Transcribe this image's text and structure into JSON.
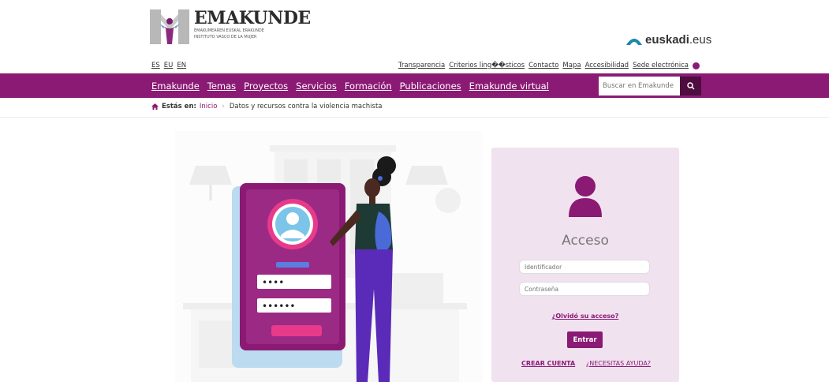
{
  "header": {
    "logo_title": "EMAKUNDE",
    "logo_sub1": "EMAKUMEAREN EUSKAL ERAKUNDE",
    "logo_sub2": "INSTITUTO VASCO DE LA MUJER",
    "gov_brand": "euskadi",
    "gov_tld": ".eus"
  },
  "languages": [
    "ES",
    "EU",
    "EN"
  ],
  "utility_links": [
    "Transparencia",
    "Criterios ling��sticos",
    "Contacto",
    "Mapa",
    "Accesibilidad",
    "Sede electrónica"
  ],
  "nav": {
    "items": [
      "Emakunde",
      "Temas",
      "Proyectos",
      "Servicios",
      "Formación",
      "Publicaciones",
      "Emakunde virtual"
    ],
    "search_placeholder": "Buscar en Emakunde"
  },
  "breadcrumb": {
    "label": "Estás en:",
    "home": "Inicio",
    "current": "Datos y recursos contra la violencia machista"
  },
  "illustration": {
    "pin_masked": "••••",
    "password_masked": "••••••"
  },
  "login": {
    "title": "Acceso",
    "user_placeholder": "Identificador",
    "password_placeholder": "Contraseña",
    "forgot_link": "¿Olvidó su acceso?",
    "submit_label": "Entrar",
    "create_account": "CREAR CUENTA",
    "need_help": "¿NECESITAS AYUDA?"
  },
  "colors": {
    "brand_purple": "#8a1a74",
    "search_button": "#4e0c40",
    "login_panel": "#f1e2ef",
    "euskadi_teal": "#1a88a8"
  }
}
